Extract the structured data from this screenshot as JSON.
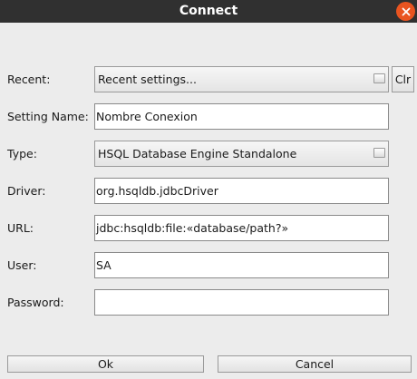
{
  "window": {
    "title": "Connect"
  },
  "form": {
    "recent": {
      "label": "Recent:",
      "value": "Recent settings...",
      "clear_label": "Clr"
    },
    "setting_name": {
      "label": "Setting Name:",
      "value": "Nombre Conexion"
    },
    "type": {
      "label": "Type:",
      "value": "HSQL Database Engine Standalone"
    },
    "driver": {
      "label": "Driver:",
      "value": "org.hsqldb.jdbcDriver"
    },
    "url": {
      "label": "URL:",
      "value": "jdbc:hsqldb:file:«database/path?»"
    },
    "user": {
      "label": "User:",
      "value": "SA"
    },
    "password": {
      "label": "Password:",
      "value": ""
    }
  },
  "buttons": {
    "ok": "Ok",
    "cancel": "Cancel"
  },
  "icons": {
    "close": "close-icon",
    "combo_arrow": "dropdown-arrow-icon"
  },
  "colors": {
    "titlebar": "#303030",
    "close_button": "#e95420",
    "dialog_background": "#ececec"
  }
}
